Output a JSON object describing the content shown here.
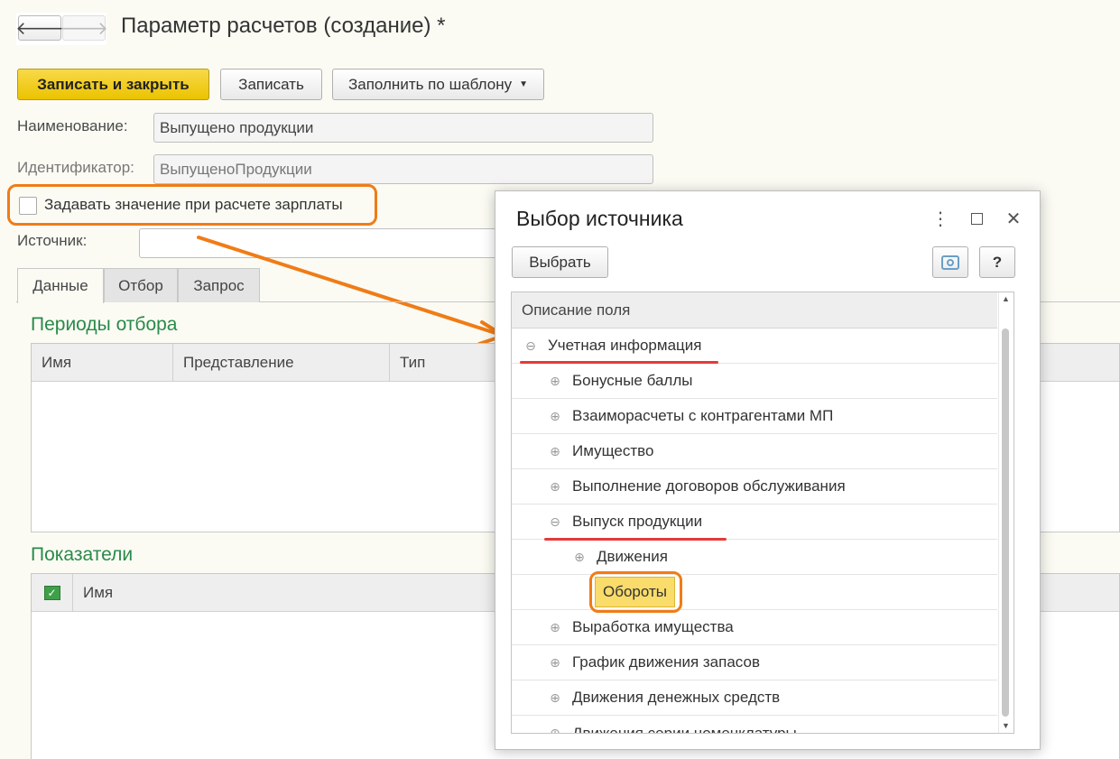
{
  "nav": {
    "back_icon": "arrow-left-icon",
    "forward_icon": "arrow-right-icon"
  },
  "page": {
    "title": "Параметр расчетов (создание) *"
  },
  "toolbar": {
    "save_close_label": "Записать и закрыть",
    "save_label": "Записать",
    "fill_template_label": "Заполнить по шаблону"
  },
  "form": {
    "name_label": "Наименование:",
    "name_value": "Выпущено продукции",
    "id_label": "Идентификатор:",
    "id_value": "ВыпущеноПродукции",
    "checkbox_label": "Задавать значение при расчете зарплаты",
    "checkbox_checked": false,
    "source_label": "Источник:",
    "source_value": ""
  },
  "tabs": [
    {
      "label": "Данные",
      "active": true
    },
    {
      "label": "Отбор",
      "active": false
    },
    {
      "label": "Запрос",
      "active": false
    }
  ],
  "periods": {
    "title": "Периоды отбора",
    "columns": [
      "Имя",
      "Представление",
      "Тип"
    ]
  },
  "indicators": {
    "title": "Показатели",
    "columns": [
      "Имя"
    ]
  },
  "dialog": {
    "title": "Выбор источника",
    "select_label": "Выбрать",
    "help_label": "?",
    "tree_header": "Описание поля",
    "tree": [
      {
        "label": "Учетная информация",
        "level": 0,
        "toggle": "minus",
        "underlined": true
      },
      {
        "label": "Бонусные баллы",
        "level": 1,
        "toggle": "plus"
      },
      {
        "label": "Взаиморасчеты с контрагентами МП",
        "level": 1,
        "toggle": "plus"
      },
      {
        "label": "Имущество",
        "level": 1,
        "toggle": "plus"
      },
      {
        "label": "Выполнение договоров обслуживания",
        "level": 1,
        "toggle": "plus"
      },
      {
        "label": "Выпуск продукции",
        "level": 1,
        "toggle": "minus",
        "underlined": true
      },
      {
        "label": "Движения",
        "level": 2,
        "toggle": "plus"
      },
      {
        "label": "Обороты",
        "level": 2,
        "toggle": "none",
        "selected": true
      },
      {
        "label": "Выработка имущества",
        "level": 1,
        "toggle": "plus"
      },
      {
        "label": "График движения запасов",
        "level": 1,
        "toggle": "plus"
      },
      {
        "label": "Движения денежных средств",
        "level": 1,
        "toggle": "plus"
      },
      {
        "label": "Движения серии номенклатуры",
        "level": 1,
        "toggle": "plus"
      }
    ]
  },
  "colors": {
    "accent": "#f07c16",
    "primary_button": "#ebc300",
    "section_title": "#2a8a4a",
    "underline": "#e43a3a"
  }
}
